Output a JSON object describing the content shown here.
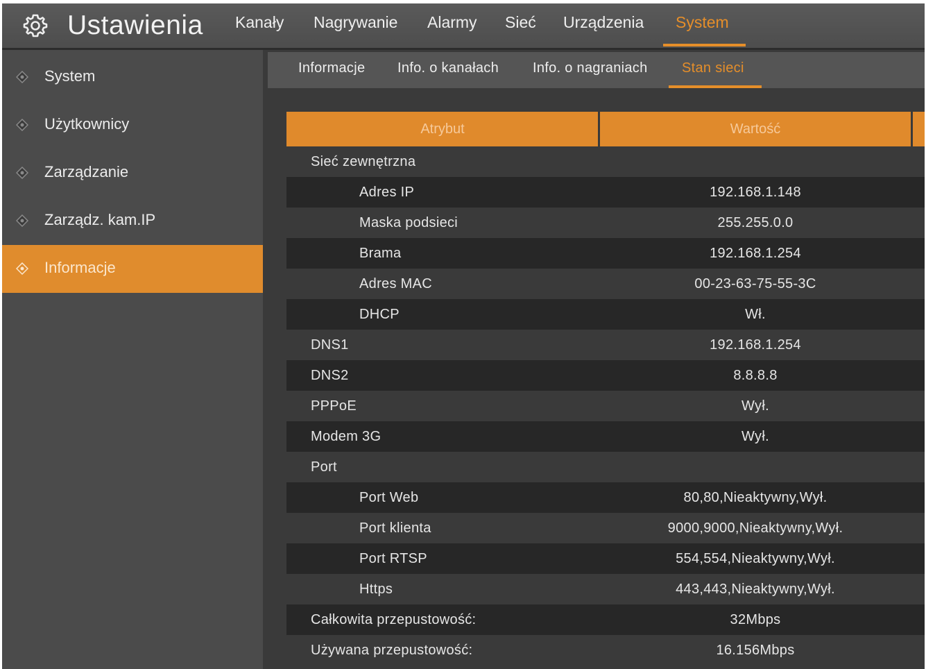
{
  "header": {
    "title": "Ustawienia",
    "icon": "gear-icon",
    "tabs": [
      {
        "label": "Kanały"
      },
      {
        "label": "Nagrywanie"
      },
      {
        "label": "Alarmy"
      },
      {
        "label": "Sieć"
      },
      {
        "label": "Urządzenia"
      },
      {
        "label": "System"
      }
    ],
    "active_tab": "System"
  },
  "sidebar": {
    "items": [
      {
        "label": "System"
      },
      {
        "label": "Użytkownicy"
      },
      {
        "label": "Zarządzanie"
      },
      {
        "label": "Zarządz. kam.IP"
      },
      {
        "label": "Informacje"
      }
    ],
    "active_item": "Informacje"
  },
  "subtabs": {
    "items": [
      {
        "label": "Informacje"
      },
      {
        "label": "Info. o kanałach"
      },
      {
        "label": "Info. o nagraniach"
      },
      {
        "label": "Stan sieci"
      }
    ],
    "active": "Stan sieci"
  },
  "table": {
    "headers": {
      "attribute": "Atrybut",
      "value": "Wartość"
    },
    "rows": [
      {
        "attr": "Sieć zewnętrzna",
        "value": "",
        "indent": 0
      },
      {
        "attr": "Adres IP",
        "value": "192.168.1.148",
        "indent": 1
      },
      {
        "attr": "Maska podsieci",
        "value": "255.255.0.0",
        "indent": 1
      },
      {
        "attr": "Brama",
        "value": "192.168.1.254",
        "indent": 1
      },
      {
        "attr": "Adres MAC",
        "value": "00-23-63-75-55-3C",
        "indent": 1
      },
      {
        "attr": "DHCP",
        "value": "Wł.",
        "indent": 1
      },
      {
        "attr": "DNS1",
        "value": "192.168.1.254",
        "indent": 0
      },
      {
        "attr": "DNS2",
        "value": "8.8.8.8",
        "indent": 0
      },
      {
        "attr": "PPPoE",
        "value": "Wył.",
        "indent": 0
      },
      {
        "attr": "Modem 3G",
        "value": "Wył.",
        "indent": 0
      },
      {
        "attr": "Port",
        "value": "",
        "indent": 0
      },
      {
        "attr": "Port Web",
        "value": "80,80,Nieaktywny,Wył.",
        "indent": 1
      },
      {
        "attr": "Port klienta",
        "value": "9000,9000,Nieaktywny,Wył.",
        "indent": 1
      },
      {
        "attr": "Port RTSP",
        "value": "554,554,Nieaktywny,Wył.",
        "indent": 1
      },
      {
        "attr": "Https",
        "value": "443,443,Nieaktywny,Wył.",
        "indent": 1
      },
      {
        "attr": "Całkowita przepustowość:",
        "value": "32Mbps",
        "indent": 0
      },
      {
        "attr": "Używana przepustowość:",
        "value": "16.156Mbps",
        "indent": 0
      }
    ]
  },
  "colors": {
    "accent": "#e58e2a",
    "background": "#3a3a3a",
    "sidebar": "#4b4b4b",
    "row_dark": "#272727"
  }
}
